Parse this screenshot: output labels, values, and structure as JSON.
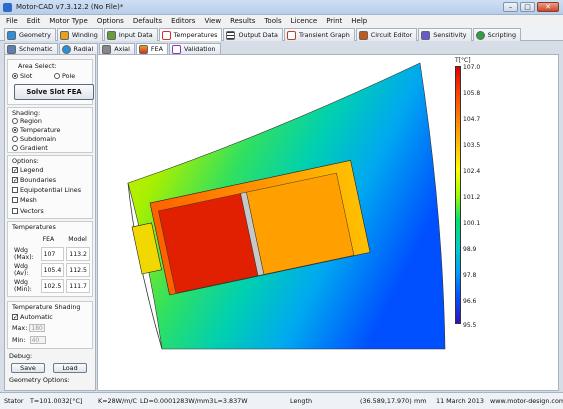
{
  "window": {
    "title": "Motor-CAD v7.3.12.2 (No File)*"
  },
  "menu": [
    "File",
    "Edit",
    "Motor Type",
    "Options",
    "Defaults",
    "Editors",
    "View",
    "Results",
    "Tools",
    "Licence",
    "Print",
    "Help"
  ],
  "main_tabs": [
    {
      "label": "Geometry",
      "icon": "geometry-icon",
      "color": "#2b8fd9"
    },
    {
      "label": "Winding",
      "icon": "winding-icon",
      "color": "#e8a11a"
    },
    {
      "label": "Input Data",
      "icon": "input-data-icon",
      "color": "#6b9c3a"
    },
    {
      "label": "Temperatures",
      "icon": "thermometer-icon",
      "color": "#d23030"
    },
    {
      "label": "Output Data",
      "icon": "output-data-icon",
      "color": "#333333"
    },
    {
      "label": "Transient Graph",
      "icon": "graph-icon",
      "color": "#b8402a"
    },
    {
      "label": "Circuit Editor",
      "icon": "circuit-icon",
      "color": "#c25a1a"
    },
    {
      "label": "Sensitivity",
      "icon": "sensitivity-icon",
      "color": "#6a5acd"
    },
    {
      "label": "Scripting",
      "icon": "scripting-icon",
      "color": "#2ea043"
    }
  ],
  "sub_tabs": [
    {
      "label": "Schematic",
      "icon": "schematic-icon",
      "color": "#5a7fb0"
    },
    {
      "label": "Radial",
      "icon": "radial-icon",
      "color": "#2b8fd9"
    },
    {
      "label": "Axial",
      "icon": "axial-icon",
      "color": "#555555"
    },
    {
      "label": "FEA",
      "icon": "fea-icon",
      "color": "#e8a11a"
    },
    {
      "label": "Validation",
      "icon": "validation-icon",
      "color": "#8a3ab8"
    }
  ],
  "left": {
    "area_select": {
      "title": "Area Select:",
      "opt1": "Slot",
      "opt2": "Pole"
    },
    "solve_button": "Solve Slot FEA",
    "shading": {
      "title": "Shading:",
      "options": [
        "Region",
        "Temperature",
        "Subdomain",
        "Gradient"
      ]
    },
    "options": {
      "title": "Options:",
      "items": [
        "Legend",
        "Boundaries",
        "Equipotential Lines",
        "Mesh",
        "Vectors"
      ]
    },
    "temperatures": {
      "title": "Temperatures",
      "col1": "FEA",
      "col2": "Model",
      "rows": [
        {
          "label": "Wdg (Max):",
          "fea": "107",
          "model": "113.2"
        },
        {
          "label": "Wdg (Av):",
          "fea": "105.4",
          "model": "112.5"
        },
        {
          "label": "Wdg (Min):",
          "fea": "102.5",
          "model": "111.7"
        }
      ]
    },
    "temp_shading": {
      "title": "Temperature Shading",
      "automatic": "Automatic",
      "max_label": "Max:",
      "max_value": "180",
      "min_label": "Min:",
      "min_value": "40"
    },
    "debug": {
      "title": "Debug:",
      "save": "Save",
      "load": "Load"
    },
    "geometry_options": "Geometry Options:"
  },
  "legend": {
    "unit": "T[°C]",
    "ticks": [
      "107.0",
      "105.8",
      "104.7",
      "103.5",
      "102.4",
      "101.2",
      "100.1",
      "98.9",
      "97.8",
      "96.6",
      "95.5"
    ]
  },
  "status": {
    "region": "Stator",
    "temp": "T=101.0032[°C]",
    "k": "K=28W/m/C",
    "ld": "LD=0.0001283W/mm3",
    "l": "L=3.837W",
    "length_label": "Length",
    "coords": "(36.589,17.970)",
    "unit": "mm",
    "date": "11 March 2013",
    "url": "www.motor-design.com"
  }
}
